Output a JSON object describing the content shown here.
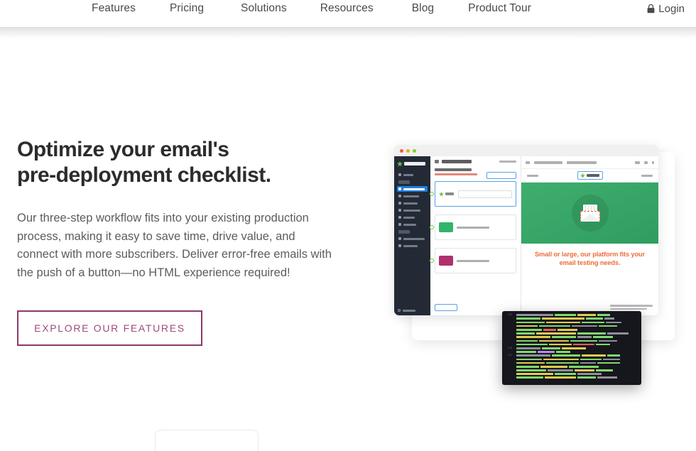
{
  "header": {
    "nav_items": [
      {
        "label": "Features"
      },
      {
        "label": "Pricing"
      },
      {
        "label": "Solutions"
      },
      {
        "label": "Resources"
      },
      {
        "label": "Blog"
      },
      {
        "label": "Product Tour"
      }
    ],
    "login": {
      "label": "Login",
      "icon": "lock-icon"
    }
  },
  "hero": {
    "title_line1": "Optimize your email's",
    "title_line2": "pre-deployment checklist.",
    "paragraph": "Our three-step workflow fits into your existing production process, making it easy to save time, drive value, and connect with more subscribers. Deliver error-free emails with the push of a button—no HTML experience required!",
    "cta_label": "EXPLORE OUR FEATURES"
  },
  "mockup": {
    "window_dots": [
      "red",
      "yellow",
      "green"
    ],
    "email_preview_caption": "Small or large, our platform fits your email testing needs.",
    "code_line_numbers": [
      "215",
      "170",
      "271"
    ]
  },
  "colors": {
    "cta_border": "#8b3a68",
    "cta_text": "#9d4a79",
    "nav_text": "#4a4a4a",
    "title": "#2c2c2c",
    "body_text": "#5c5c5c",
    "sidebar_dark": "#232a35",
    "sidebar_active": "#1e7fe0",
    "preview_green": "#3fae6d",
    "preview_caption": "#ef6c3b",
    "code_bg": "#16161d"
  }
}
